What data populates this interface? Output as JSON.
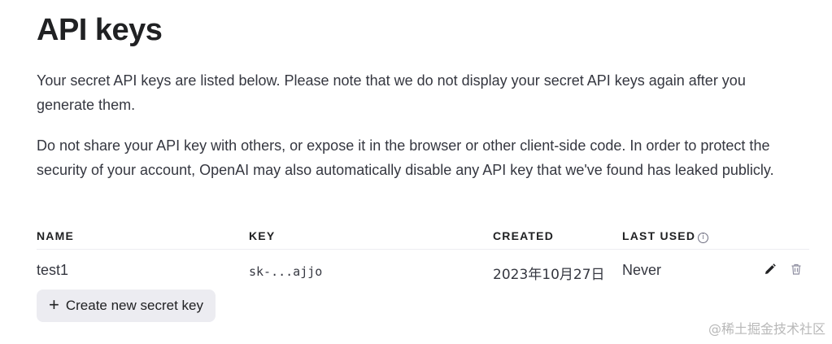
{
  "page": {
    "title": "API keys",
    "description_1": "Your secret API keys are listed below. Please note that we do not display your secret API keys again after you generate them.",
    "description_2": "Do not share your API key with others, or expose it in the browser or other client-side code. In order to protect the security of your account, OpenAI may also automatically disable any API key that we've found has leaked publicly."
  },
  "table": {
    "headers": {
      "name": "NAME",
      "key": "KEY",
      "created": "CREATED",
      "last_used": "LAST USED"
    },
    "rows": [
      {
        "name": "test1",
        "key": "sk-...ajjo",
        "created": "2023年10月27日",
        "last_used": "Never"
      }
    ]
  },
  "actions": {
    "create_label": "Create new secret key"
  },
  "icons": {
    "info": "info-icon",
    "edit": "pencil-icon",
    "delete": "trash-icon",
    "add": "plus-icon"
  },
  "watermark": "@稀土掘金技术社区"
}
